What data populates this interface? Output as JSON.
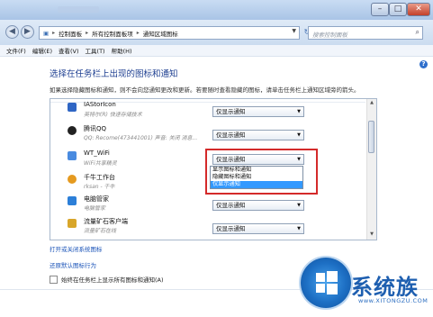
{
  "window": {
    "min_glyph": "–",
    "max_glyph": "□",
    "close_glyph": "✕"
  },
  "address": {
    "crumbs": [
      "控制面板",
      "所有控制面板项",
      "通知区域图标"
    ],
    "search_placeholder": "搜索控制面板"
  },
  "menu": [
    "文件(F)",
    "编辑(E)",
    "查看(V)",
    "工具(T)",
    "帮助(H)"
  ],
  "page": {
    "heading": "选择在任务栏上出现的图标和通知",
    "description": "如果选择隐藏图标和通知，则不会向您通知更改和更新。若要随时查看隐藏的图标，请单击任务栏上通知区域旁的箭头。",
    "help_glyph": "?"
  },
  "items": [
    {
      "name": "IAStorIcon",
      "sub": "英特尔(R) 快速存储技术",
      "setting": "仅显示通知",
      "icon_color": "#2f66c4"
    },
    {
      "name": "腾讯QQ",
      "sub": "QQ: Recome(473441001)  声音: 关闭  消息...",
      "setting": "仅显示通知",
      "icon_color": "#222222"
    },
    {
      "name": "WT_WiFi",
      "sub": "WiFi共享精灵",
      "setting": "仅显示通知",
      "icon_color": "#4a8be0"
    },
    {
      "name": "千牛工作台",
      "sub": "rksan - 千牛",
      "setting": "",
      "icon_color": "#e59a1f"
    },
    {
      "name": "电脑管家",
      "sub": "电脑管家",
      "setting": "仅显示通知",
      "icon_color": "#2c7fd8"
    },
    {
      "name": "流量矿石客户端",
      "sub": "流量矿石在线",
      "setting": "仅显示通知",
      "icon_color": "#d8a62a"
    }
  ],
  "dropdown_options": [
    {
      "label": "显示图标和通知"
    },
    {
      "label": "隐藏图标和通知"
    },
    {
      "label": "仅显示通知"
    }
  ],
  "links": {
    "system_icons": "打开或关闭系统图标",
    "restore": "还原默认图标行为"
  },
  "checkbox": {
    "label": "始终在任务栏上显示所有图标和通知(A)",
    "checked": false
  },
  "watermark": {
    "brand": "系统族",
    "url": "www.XITONGZU.COM"
  }
}
